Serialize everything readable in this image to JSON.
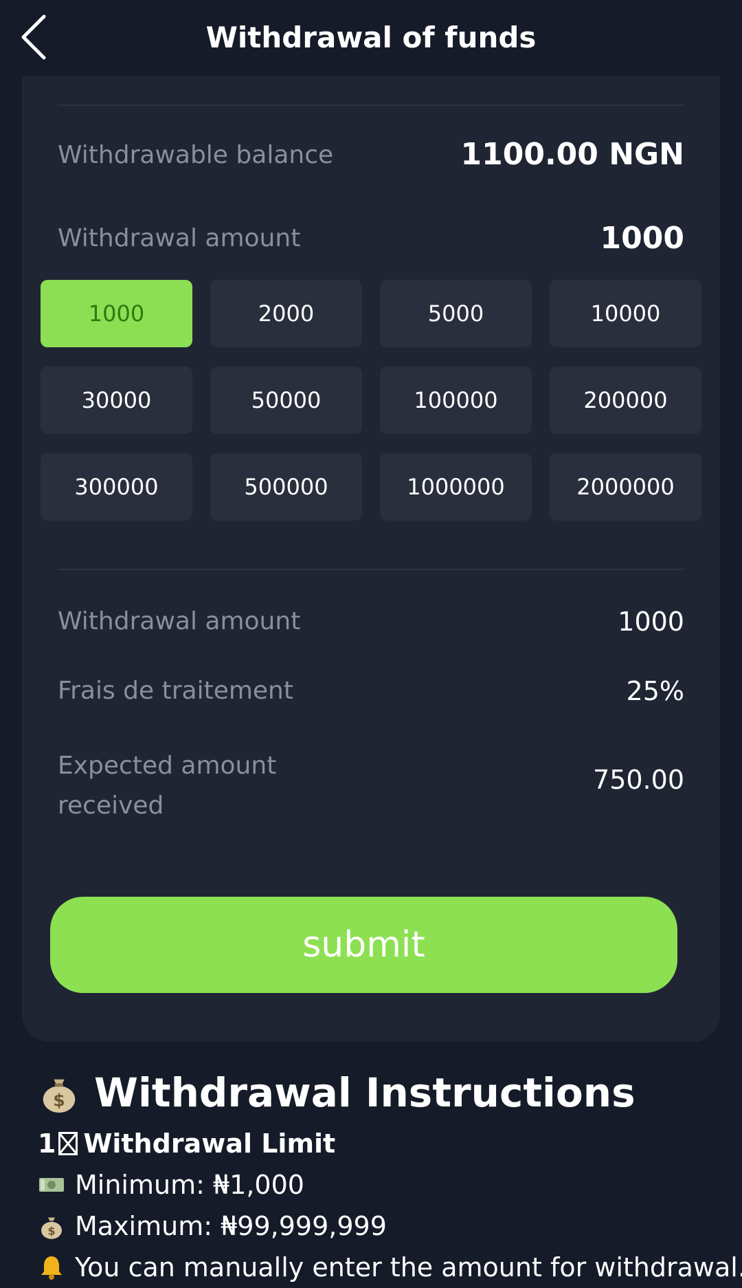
{
  "header": {
    "title": "Withdrawal of funds",
    "back_icon": "chevron-left-icon"
  },
  "balance": {
    "label": "Withdrawable balance",
    "value": "1100.00 NGN"
  },
  "amount_input": {
    "label": "Withdrawal amount",
    "value": "1000"
  },
  "amount_options": [
    "1000",
    "2000",
    "5000",
    "10000",
    "30000",
    "50000",
    "100000",
    "200000",
    "300000",
    "500000",
    "1000000",
    "2000000"
  ],
  "selected_amount": "1000",
  "summary": {
    "withdrawal_amount_label": "Withdrawal amount",
    "withdrawal_amount_value": "1000",
    "fee_label": "Frais de traitement",
    "fee_value": "25%",
    "expected_label_line1": "Expected amount",
    "expected_label_line2": "received",
    "expected_value": "750.00"
  },
  "submit_label": "submit",
  "instructions": {
    "title": "Withdrawal Instructions",
    "title_icon": "money-bag-icon",
    "section_prefix": "1",
    "section_title": "Withdrawal Limit",
    "minimum": "Minimum: ₦1,000",
    "minimum_icon": "banknote-icon",
    "maximum": "Maximum: ₦99,999,999",
    "maximum_icon": "money-bag-icon",
    "manual_note": "You can manually enter the amount for withdrawal.",
    "manual_icon": "bell-icon"
  },
  "colors": {
    "accent": "#8ce052",
    "selected_text": "#2c7a10",
    "background": "#161b29",
    "card": "#202534",
    "button": "#2a2f3d",
    "muted_text": "#8a8f9c"
  }
}
